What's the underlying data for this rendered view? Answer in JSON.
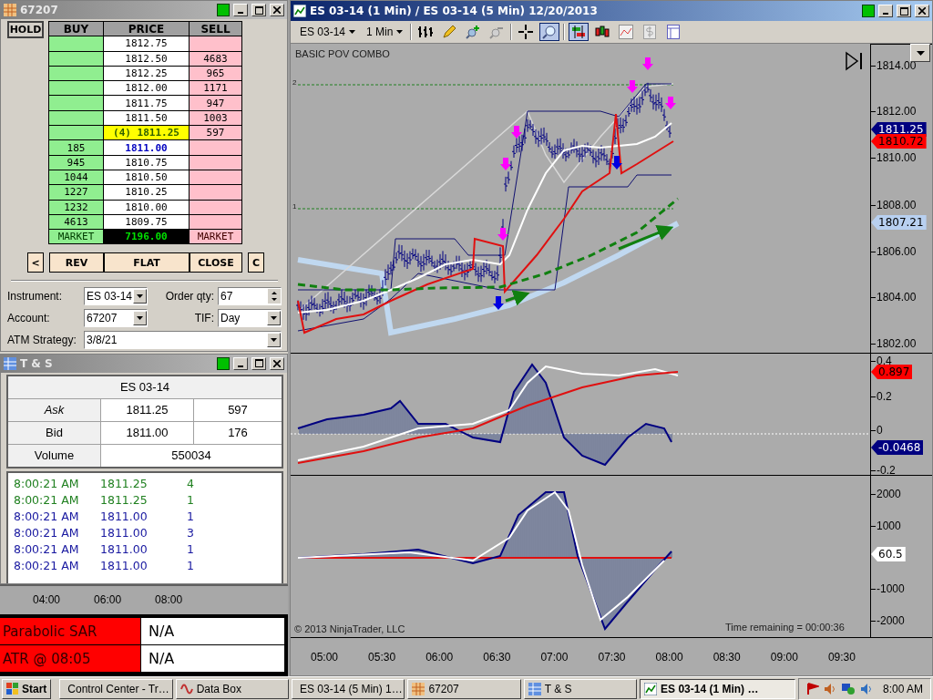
{
  "dom_window": {
    "title": "67207",
    "hold": "HOLD",
    "columns": [
      "BUY",
      "PRICE",
      "SELL"
    ],
    "rows": [
      {
        "buy": "",
        "price": "1812.75",
        "sell": "",
        "kind": "normal"
      },
      {
        "buy": "",
        "price": "1812.50",
        "sell": "4683",
        "kind": "normal"
      },
      {
        "buy": "",
        "price": "1812.25",
        "sell": "965",
        "kind": "normal"
      },
      {
        "buy": "",
        "price": "1812.00",
        "sell": "1171",
        "kind": "normal"
      },
      {
        "buy": "",
        "price": "1811.75",
        "sell": "947",
        "kind": "normal"
      },
      {
        "buy": "",
        "price": "1811.50",
        "sell": "1003",
        "kind": "normal"
      },
      {
        "buy": "",
        "price": "(4) 1811.25",
        "sell": "597",
        "kind": "last"
      },
      {
        "buy": "185",
        "price": "1811.00",
        "sell": "",
        "kind": "bid"
      },
      {
        "buy": "945",
        "price": "1810.75",
        "sell": "",
        "kind": "normal"
      },
      {
        "buy": "1044",
        "price": "1810.50",
        "sell": "",
        "kind": "normal"
      },
      {
        "buy": "1227",
        "price": "1810.25",
        "sell": "",
        "kind": "normal"
      },
      {
        "buy": "1232",
        "price": "1810.00",
        "sell": "",
        "kind": "normal"
      },
      {
        "buy": "4613",
        "price": "1809.75",
        "sell": "",
        "kind": "normal"
      }
    ],
    "market": {
      "buy": "MARKET",
      "price": "7196.00",
      "sell": "MARKET"
    },
    "buttons": {
      "left": "<",
      "rev": "REV",
      "flat": "FLAT",
      "close": "CLOSE",
      "right": "C"
    },
    "fields": [
      {
        "label": "Instrument:",
        "value": "ES 03-14",
        "kind": "select"
      },
      {
        "label": "Order qty:",
        "value": "67",
        "kind": "spin"
      },
      {
        "label": "Account:",
        "value": "67207",
        "kind": "select"
      },
      {
        "label": "TIF:",
        "value": "Day",
        "kind": "select"
      },
      {
        "label": "ATM Strategy:",
        "value": "3/8/21",
        "kind": "wide"
      }
    ]
  },
  "ts_window": {
    "title": "T & S",
    "instrument": "ES 03-14",
    "quotes": [
      {
        "label": "Ask",
        "price": "1811.25",
        "size": "597"
      },
      {
        "label": "Bid",
        "price": "1811.00",
        "size": "176"
      }
    ],
    "volume": {
      "label": "Volume",
      "value": "550034"
    },
    "trades": [
      {
        "time": "8:00:21 AM",
        "price": "1811.25",
        "size": "4",
        "kind": "ask"
      },
      {
        "time": "8:00:21 AM",
        "price": "1811.25",
        "size": "1",
        "kind": "ask"
      },
      {
        "time": "8:00:21 AM",
        "price": "1811.00",
        "size": "1",
        "kind": "bid"
      },
      {
        "time": "8:00:21 AM",
        "price": "1811.00",
        "size": "3",
        "kind": "bid"
      },
      {
        "time": "8:00:21 AM",
        "price": "1811.00",
        "size": "1",
        "kind": "bid"
      },
      {
        "time": "8:00:21 AM",
        "price": "1811.00",
        "size": "1",
        "kind": "bid"
      }
    ]
  },
  "mini_axis": [
    "04:00",
    "06:00",
    "08:00"
  ],
  "indicators": [
    {
      "name": "Parabolic SAR",
      "value": "N/A"
    },
    {
      "name": "ATR @ 08:05",
      "value": "N/A"
    }
  ],
  "chart_window": {
    "title": "ES 03-14 (1 Min) / ES 03-14 (5 Min)  12/20/2013",
    "toolbar": {
      "instrument": "ES 03-14",
      "interval": "1 Min",
      "tools": [
        {
          "kind": "bars",
          "selected": false
        },
        {
          "kind": "pencil",
          "selected": false
        },
        {
          "kind": "zoom-in",
          "selected": false
        },
        {
          "kind": "zoom-out",
          "selected": false
        },
        {
          "kind": "crosshair",
          "selected": false
        },
        {
          "kind": "magnifier",
          "selected": true
        },
        {
          "kind": "strategy",
          "selected": true
        },
        {
          "kind": "candles",
          "selected": false
        },
        {
          "kind": "lines",
          "selected": false
        },
        {
          "kind": "dollar",
          "selected": false
        },
        {
          "kind": "panel",
          "selected": false
        }
      ]
    },
    "chart_name": "BASIC POV COMBO",
    "level_labels": [
      "2",
      "1"
    ],
    "price_axis": [
      "1814.00",
      "1812.00",
      "1810.00",
      "1808.00",
      "1806.00",
      "1804.00",
      "1802.00"
    ],
    "price_flags": [
      {
        "text": "1811.25",
        "color": "#000080"
      },
      {
        "text": "1810.72",
        "color": "#ff0000"
      },
      {
        "text": "1807.21",
        "color": "#b8d0f0"
      }
    ],
    "osc_axis": [
      "0.4",
      "0.2",
      "0",
      "-0.2"
    ],
    "osc_flags": [
      {
        "text": "0.897",
        "color": "#ff0000"
      },
      {
        "text": "-0.0468",
        "color": "#000080"
      }
    ],
    "lower_axis": [
      "2000",
      "1000",
      "-1000",
      "-2000"
    ],
    "lower_flags": [
      {
        "text": "60.5",
        "color": "#ffffff"
      }
    ],
    "copyright": "© 2013 NinjaTrader, LLC",
    "time_remaining": "Time remaining = 00:00:36",
    "time_axis": [
      "05:00",
      "05:30",
      "06:00",
      "06:30",
      "07:00",
      "07:30",
      "08:00",
      "08:30",
      "09:00",
      "09:30"
    ]
  },
  "taskbar": {
    "start": "Start",
    "items": [
      {
        "label": "Control Center - Tr…",
        "selected": false
      },
      {
        "label": "Data Box",
        "selected": false
      },
      {
        "label": "ES 03-14 (5 Min)  1…",
        "selected": false
      },
      {
        "label": "67207",
        "selected": false
      },
      {
        "label": "T & S",
        "selected": false
      },
      {
        "label": "ES 03-14 (1 Min) …",
        "selected": true
      }
    ],
    "clock": "8:00 AM"
  }
}
